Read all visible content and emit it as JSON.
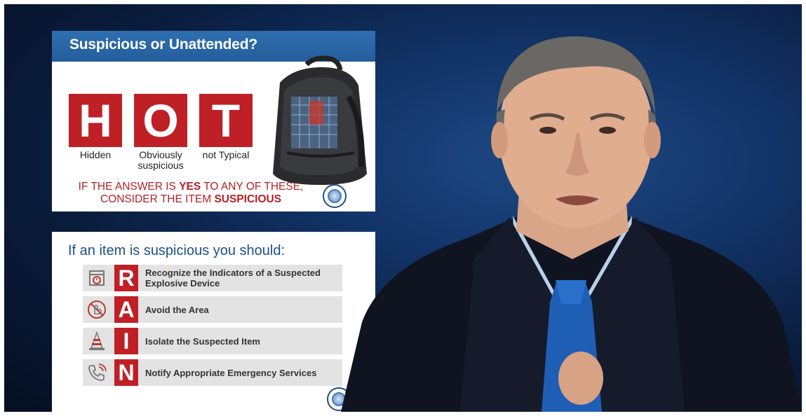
{
  "hot_panel": {
    "title": "Suspicious or Unattended?",
    "letters": [
      {
        "letter": "H",
        "caption": "Hidden"
      },
      {
        "letter": "O",
        "caption": "Obviously suspicious"
      },
      {
        "letter": "T",
        "caption": "not Typical"
      }
    ],
    "warning_line1_a": "IF THE ANSWER IS ",
    "warning_line1_b": "YES",
    "warning_line1_c": " TO ANY OF THESE,",
    "warning_line2_a": "CONSIDER THE ITEM ",
    "warning_line2_b": "SUSPICIOUS"
  },
  "rain_panel": {
    "title": "If an item is suspicious you should:",
    "rows": [
      {
        "letter": "R",
        "text": "Recognize the Indicators of a Suspected Explosive Device",
        "icon": "calendar-clock-icon"
      },
      {
        "letter": "A",
        "text": "Avoid the Area",
        "icon": "no-touch-hand-icon"
      },
      {
        "letter": "I",
        "text": "Isolate the Suspected Item",
        "icon": "traffic-cone-icon"
      },
      {
        "letter": "N",
        "text": "Notify Appropriate Emergency Services",
        "icon": "phone-ringing-icon"
      }
    ]
  },
  "colors": {
    "brand_red": "#bf2026",
    "header_blue": "#2a66a6",
    "title_blue": "#1d4f86",
    "background_navy": "#0b1f44"
  }
}
